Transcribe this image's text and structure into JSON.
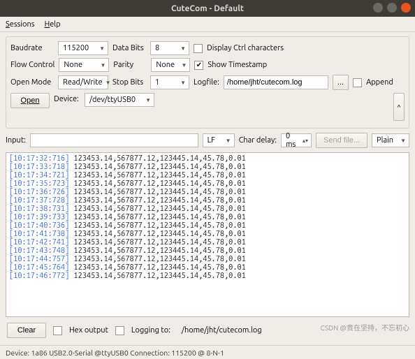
{
  "window": {
    "title": "CuteCom - Default"
  },
  "menu": {
    "sessions": "Sessions",
    "help": "Help"
  },
  "settings": {
    "baudrate": {
      "label": "Baudrate",
      "value": "115200"
    },
    "databits": {
      "label": "Data Bits",
      "value": "8"
    },
    "displayctrl": {
      "label": "Display Ctrl characters",
      "checked": false
    },
    "flowcontrol": {
      "label": "Flow Control",
      "value": "None"
    },
    "parity": {
      "label": "Parity",
      "value": "None"
    },
    "timestamp": {
      "label": "Show Timestamp",
      "checked": true
    },
    "openmode": {
      "label": "Open Mode",
      "value": "Read/Write"
    },
    "stopbits": {
      "label": "Stop Bits",
      "value": "1"
    },
    "logfile": {
      "label": "Logfile:",
      "path": "/home/jht/cutecom.log",
      "append": "Append",
      "browse": "..."
    },
    "openbtn": "Open",
    "device": {
      "label": "Device:",
      "value": "/dev/ttyUSB0"
    }
  },
  "input": {
    "label": "Input:",
    "value": "",
    "lineend": "LF",
    "chardelay": {
      "label": "Char delay:",
      "value": "0 ms"
    },
    "sendfile": "Send file...",
    "mode": "Plain"
  },
  "log_lines": [
    {
      "ts": "[10:17:32:716]",
      "data": " 123453.14,567877.12,123445.14,45.78,0.01"
    },
    {
      "ts": "[10:17:33:718]",
      "data": " 123453.14,567877.12,123445.14,45.78,0.01"
    },
    {
      "ts": "[10:17:34:721]",
      "data": " 123453.14,567877.12,123445.14,45.78,0.01"
    },
    {
      "ts": "[10:17:35:723]",
      "data": " 123453.14,567877.12,123445.14,45.78,0.01"
    },
    {
      "ts": "[10:17:36:726]",
      "data": " 123453.14,567877.12,123445.14,45.78,0.01"
    },
    {
      "ts": "[10:17:37:728]",
      "data": " 123453.14,567877.12,123445.14,45.78,0.01"
    },
    {
      "ts": "[10:17:38:731]",
      "data": " 123453.14,567877.12,123445.14,45.78,0.01"
    },
    {
      "ts": "[10:17:39:733]",
      "data": " 123453.14,567877.12,123445.14,45.78,0.01"
    },
    {
      "ts": "[10:17:40:736]",
      "data": " 123453.14,567877.12,123445.14,45.78,0.01"
    },
    {
      "ts": "[10:17:41:738]",
      "data": " 123453.14,567877.12,123445.14,45.78,0.01"
    },
    {
      "ts": "[10:17:42:741]",
      "data": " 123453.14,567877.12,123445.14,45.78,0.01"
    },
    {
      "ts": "[10:17:43:748]",
      "data": " 123453.14,567877.12,123445.14,45.78,0.01"
    },
    {
      "ts": "[10:17:44:757]",
      "data": " 123453.14,567877.12,123445.14,45.78,0.01"
    },
    {
      "ts": "[10:17:45:764]",
      "data": " 123453.14,567877.12,123445.14,45.78,0.01"
    },
    {
      "ts": "[10:17:46:772]",
      "data": " 123453.14,567877.12,123445.14,45.78,0.01"
    }
  ],
  "bottom": {
    "clear": "Clear",
    "hex": "Hex output",
    "logging": "Logging to:",
    "logpath": "/home/jht/cutecom.log"
  },
  "status": "Device:  1a86 USB2.0-Serial @ttyUSB0   Connection:  115200 @ 8-N-1",
  "watermark": "CSDN @贵在坚持，不忘初心"
}
